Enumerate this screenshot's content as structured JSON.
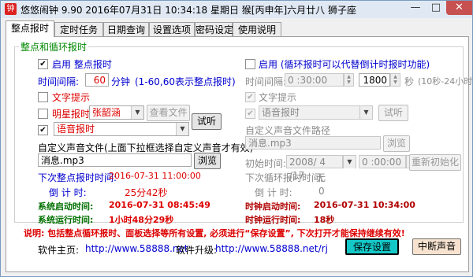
{
  "window": {
    "title": "悠悠闹钟 9.90 2016年07月31日 10:34:18 星期日 猴[丙申年]六月廿八 狮子座",
    "icon_glyph": "钟",
    "min_glyph": "—",
    "max_glyph": "□",
    "close_glyph": "✕"
  },
  "tabs": [
    "整点报时",
    "定时任务",
    "日期查询",
    "设置选项",
    "密码设定",
    "使用说明"
  ],
  "group_title": "整点和循环报时",
  "left": {
    "enable_label": "启用 整点报时",
    "interval_label": "时间间隔:",
    "interval_value": "60",
    "interval_unit": "分钟",
    "interval_hint": "(1-60,60表示整点报时)",
    "text_tip_label": "文字提示",
    "star_label": "明星报时",
    "star_value": "张韶涵",
    "view_file_btn": "查看文件",
    "test_btn": "试听",
    "voice_value": "语音报时",
    "custom_label": "自定义声音文件(上面下拉框选择自定义声音才有效)",
    "custom_file": "消息.mp3",
    "browse_btn": "浏览",
    "next_label": "下次整点报时时间:",
    "next_value": "2016-07-31 11:00:00",
    "countdown_label": "倒 计 时:",
    "countdown_value": "25分42秒",
    "sys_start_label": "系统启动时间:",
    "sys_start_value": "2016-07-31 08:45:49",
    "sys_run_label": "系统运行时间:",
    "sys_run_value": "1小时48分29秒"
  },
  "right": {
    "enable_label": "启用 (循环报时可以代替倒计时报时功能)",
    "interval_label": "时间间隔:",
    "interval_value": "0 :30:00",
    "seconds_value": "1800",
    "seconds_unit": "秒",
    "seconds_hint": "(10秒-24小时)",
    "text_tip_label": "文字提示",
    "voice_value": "语音报时",
    "test_btn": "试听",
    "custom_label": "自定义声音文件路径",
    "custom_file": "消息.mp3",
    "browse_btn": "浏览",
    "init_label": "初始时间:",
    "init_date": "2008/ 4 /17",
    "init_time": "0 :00:00",
    "reinit_btn": "重新初始化",
    "next_label": "下次循环报时时间:",
    "next_value": "无",
    "countdown_label": "倒 计 时:",
    "countdown_value": "0",
    "clock_start_label": "时钟启动时间:",
    "clock_start_value": "2016-07-31 10:34:00",
    "clock_run_label": "时钟运行时间:",
    "clock_run_value": "18秒"
  },
  "note": "说明: 包括整点循环报时、面板选择等所有设置, 必须进行“保存设置”, 下次打开才能保持继续有效!",
  "footer": {
    "home_label": "软件主页:",
    "home_url": "http://www.58888.net",
    "upgrade_label": "软件升级:",
    "upgrade_url": "http://www.58888.net/rj",
    "save_btn": "保存设置",
    "stop_btn": "中断声音"
  },
  "colors": {
    "accent_green": "#007000",
    "label_blue": "#0000d0",
    "value_red": "#d00000",
    "save_btn_bg": "#15c8c8",
    "stop_btn_bg": "#f6e2cf"
  }
}
